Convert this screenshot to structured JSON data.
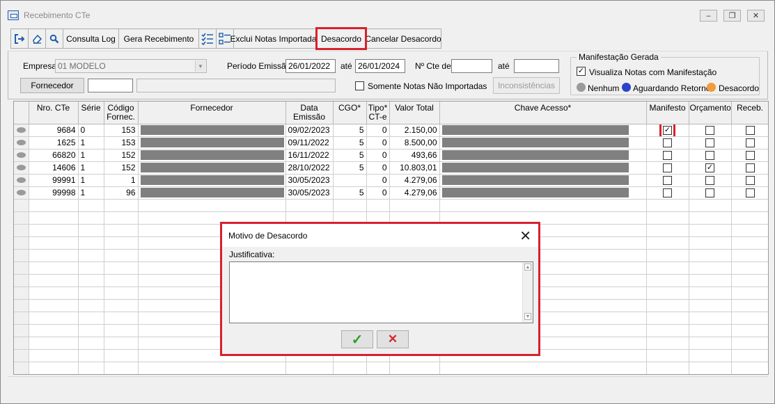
{
  "window": {
    "title": "Recebimento CTe",
    "controls": [
      "‒",
      "❐",
      "✕"
    ]
  },
  "toolbar": {
    "consulta_log": "Consulta Log",
    "gera_recebimento": "Gera Recebimento",
    "exclui_notas": "Exclui Notas Importadas",
    "desacordo": "Desacordo",
    "cancelar_desacordo": "Cancelar Desacordo"
  },
  "filters": {
    "empresa_label": "Empresa",
    "empresa_value": "01 MODELO",
    "periodo_label": "Período Emissão",
    "periodo_de": "26/01/2022",
    "ate_label": "até",
    "periodo_ate": "26/01/2024",
    "ncte_label": "Nº Cte de",
    "ncte_de": "",
    "ncte_ate": "",
    "fornecedor_button": "Fornecedor",
    "fornecedor_code": "",
    "fornecedor_name": "",
    "somente_label": "Somente Notas Não Importadas",
    "inconsistencias_button": "Inconsistências"
  },
  "manifestacao": {
    "legend": "Manifestação Gerada",
    "visualiza_label": "Visualiza Notas com Manifestação",
    "nenhum": "Nenhum",
    "aguardando": "Aguardando Retorno",
    "desacordo": "Desacordo",
    "colors": {
      "nenhum": "#9a9a9a",
      "aguardando": "#2a44c8",
      "desacordo": "#f39a3a"
    }
  },
  "grid": {
    "columns": {
      "nro": "Nro. CTe",
      "serie": "Série",
      "codigo": "Código Fornec.",
      "fornecedor": "Fornecedor",
      "data": "Data Emissão",
      "cgo": "CGO*",
      "tipo": "Tipo* CT-e",
      "valor": "Valor Total",
      "chave": "Chave Acesso*",
      "manifesto": "Manifesto",
      "orcamento": "Orçamento",
      "receb": "Receb."
    },
    "rows": [
      {
        "nro": "9684",
        "serie": "0",
        "codigo": "153",
        "data": "09/02/2023",
        "cgo": "5",
        "tipo": "0",
        "valor": "2.150,00",
        "manifesto": "✓",
        "orcamento": "",
        "receb": ""
      },
      {
        "nro": "1625",
        "serie": "1",
        "codigo": "153",
        "data": "09/11/2022",
        "cgo": "5",
        "tipo": "0",
        "valor": "8.500,00",
        "manifesto": "",
        "orcamento": "",
        "receb": ""
      },
      {
        "nro": "66820",
        "serie": "1",
        "codigo": "152",
        "data": "16/11/2022",
        "cgo": "5",
        "tipo": "0",
        "valor": "493,66",
        "manifesto": "",
        "orcamento": "",
        "receb": ""
      },
      {
        "nro": "14606",
        "serie": "1",
        "codigo": "152",
        "data": "28/10/2022",
        "cgo": "5",
        "tipo": "0",
        "valor": "10.803,01",
        "manifesto": "",
        "orcamento": "✓",
        "receb": ""
      },
      {
        "nro": "99991",
        "serie": "1",
        "codigo": "1",
        "data": "30/05/2023",
        "cgo": "",
        "tipo": "0",
        "valor": "4.279,06",
        "manifesto": "",
        "orcamento": "",
        "receb": ""
      },
      {
        "nro": "99998",
        "serie": "1",
        "codigo": "96",
        "data": "30/05/2023",
        "cgo": "5",
        "tipo": "0",
        "valor": "4.279,06",
        "manifesto": "",
        "orcamento": "",
        "receb": ""
      }
    ]
  },
  "dialog": {
    "title": "Motivo de Desacordo",
    "close": "✕",
    "justificativa_label": "Justificativa:",
    "justificativa_value": "",
    "ok": "✓",
    "cancel": "✕",
    "ok_color": "#2e9e2e",
    "cancel_color": "#d22a2a"
  }
}
